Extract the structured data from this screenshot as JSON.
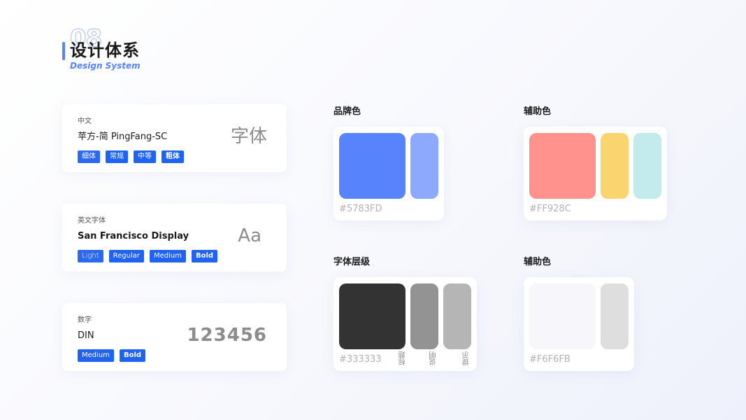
{
  "header": {
    "number": "08",
    "title": "设计体系",
    "subtitle": "Design System"
  },
  "fonts": {
    "chinese": {
      "label": "中文",
      "name": "苹方-简 PingFang-SC",
      "sample": "字体",
      "weights": [
        "细体",
        "常规",
        "中等",
        "粗体"
      ]
    },
    "english": {
      "label": "英文字体",
      "name": "San Francisco Display",
      "sample": "Aa",
      "weights": [
        "Light",
        "Regular",
        "Medium",
        "Bold"
      ]
    },
    "digits": {
      "label": "数字",
      "name": "DIN",
      "sample": "123456",
      "weights": [
        "Medium",
        "Bold"
      ]
    }
  },
  "palettes": {
    "brand": {
      "title": "品牌色",
      "hex": "#5783FD",
      "colors": [
        "#5783FD",
        "#8DA9FD"
      ]
    },
    "aux1": {
      "title": "辅助色",
      "hex": "#FF928C",
      "colors": [
        "#FF928C",
        "#FAD46E",
        "#C3EAEC"
      ]
    },
    "text": {
      "title": "字体层级",
      "hex": "#333333",
      "colors": [
        "#333333",
        "#939393",
        "#B5B5B5"
      ],
      "levels": [
        "标题",
        "说明",
        "提示"
      ]
    },
    "aux2": {
      "title": "辅助色",
      "hex": "#F6F6FB",
      "colors": [
        "#F6F6FB",
        "#DEDEDE"
      ]
    }
  },
  "colors": {
    "accent": "#5783FD",
    "tag": "#1F63F0"
  }
}
